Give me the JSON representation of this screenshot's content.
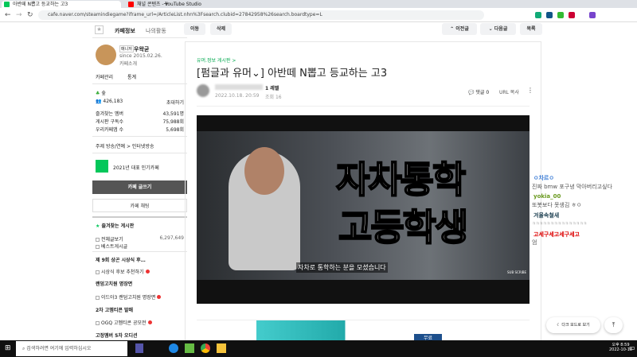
{
  "browser": {
    "tabs": [
      {
        "title": "아반떼 N뽑고 등교하는 고3"
      },
      {
        "title": "채널 콘텐츠 - YouTube Studio"
      }
    ],
    "url": "cafe.naver.com/steamindiegame?iframe_url=/ArticleList.nhn%3Fsearch.clubid=27842958%26search.boardtype=L"
  },
  "sidebar": {
    "tab_info": "카페정보",
    "tab_activity": "나의활동",
    "manager_badge": "매니저",
    "manager": "우왁굳",
    "since": "since 2015.02.26.",
    "story": "카페소개",
    "manage": "카페관리",
    "stats": "통계",
    "level": "숲",
    "members": "426,183",
    "invite": "초대하기",
    "stats_rows": [
      {
        "label": "즐겨찾는 멤버",
        "value": "43,591명"
      },
      {
        "label": "게시판 구독수",
        "value": "75,988회"
      },
      {
        "label": "우리카페앱 수",
        "value": "5,698회"
      }
    ],
    "theme": "주제  방송/연예 > 인터넷방송",
    "award": "2021년 대표 인기카페",
    "write": "카페 글쓰기",
    "chat": "카페 채팅",
    "fav_boards": "즐겨찾는 게시판",
    "all_posts": "전체글보기",
    "all_count": "6,297,649",
    "best": "베스트게시글",
    "menu": [
      "제 9회 상곤 시상식 후…",
      "시상식 후보 추천하기",
      "랜덤고치원 명장면",
      "이드아3 랜덤고치원 명장면",
      "2차 고멤티콘 발매",
      "OGQ 고멤티콘 공모전",
      "고정멤버 5차 오디션"
    ]
  },
  "toolbar": {
    "move": "이동",
    "delete": "삭제",
    "prev": "이전글",
    "next": "다음글",
    "list": "목록"
  },
  "article": {
    "board": "유머.정보 게시판 >",
    "title": "[펌글과 유머⌄] 아반떼 N뽑고 등교하는 고3",
    "level": "1 레벨",
    "date": "2022.10.18. 20:59",
    "views": "조회 16",
    "comments": "댓글 0",
    "url_copy": "URL 복사",
    "video_text1": "자차통학",
    "video_text2": "고등학생",
    "subtitle": "자차로 통학하는 분을 모셨습니다",
    "subscribe": "SUB SCRIBE",
    "ad_label": "무료"
  },
  "chat": [
    {
      "name": "ㅇ차르ㅇ",
      "color": "#3a7bd5",
      "msg": "진짜 bmw 포구녕 막아버리고싶다"
    },
    {
      "name": "yokia_00",
      "color": "#6a9a1f",
      "msg": "또봇보다 못생김 ㅎㅇ"
    },
    {
      "name": "겨울속철새",
      "color": "#245",
      "msg": "ㅋㅋㅋㅋㅋㅋㅋㅋㅋㅋㅋㅋㅋㅋㅋ"
    },
    {
      "name": "고세구세고세구세고",
      "color": "#d00",
      "msg": "엄"
    }
  ],
  "floating": {
    "dark_mode": "다크 모드로 보기"
  },
  "taskbar": {
    "search": "검색하려면 여기에 입력하십시오",
    "time": "오후 8:59",
    "date": "2022-10-18"
  }
}
